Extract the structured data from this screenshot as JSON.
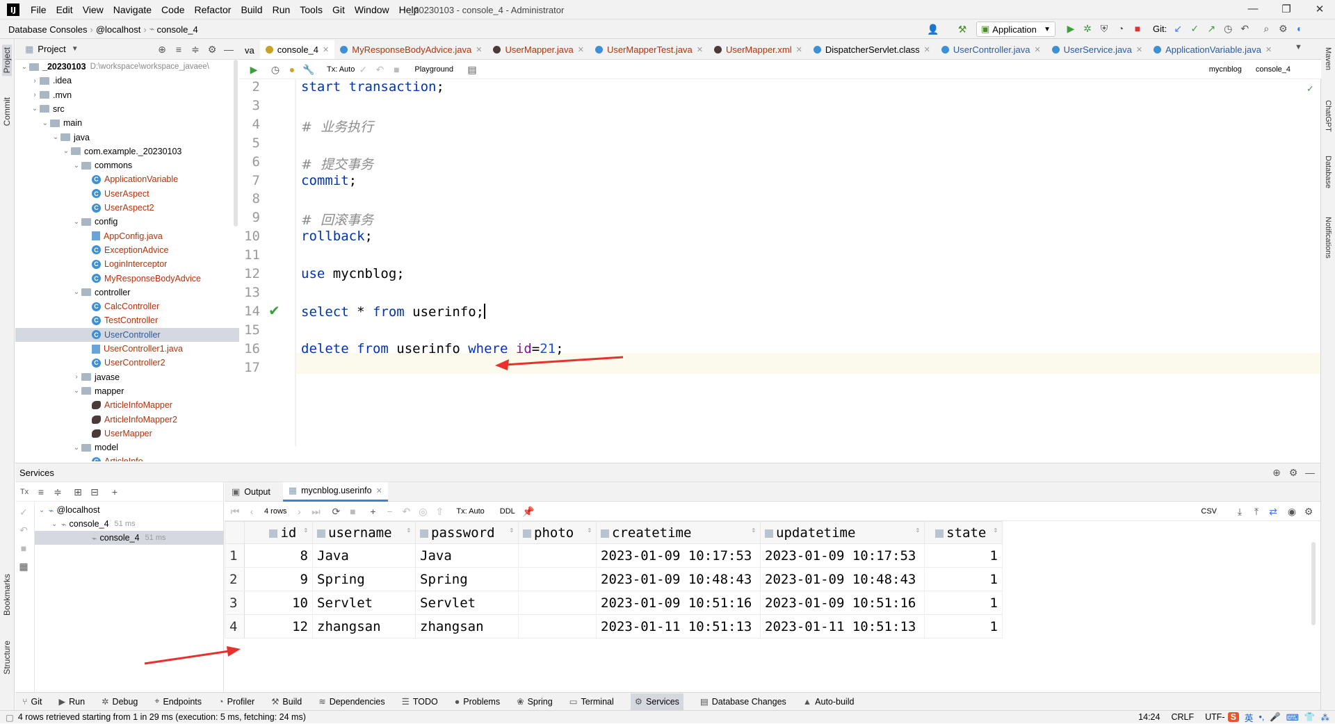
{
  "titlebar": {
    "logo": "IJ",
    "menu": [
      "File",
      "Edit",
      "View",
      "Navigate",
      "Code",
      "Refactor",
      "Build",
      "Run",
      "Tools",
      "Git",
      "Window",
      "Help"
    ],
    "window_title": "_20230103 - console_4 - Administrator"
  },
  "navbar": {
    "crumbs": [
      "Database Consoles",
      "@localhost",
      "console_4"
    ],
    "run_config": "Application",
    "git_label": "Git:"
  },
  "leftstrip": {
    "project": "Project",
    "commit": "Commit",
    "bookmarks": "Bookmarks",
    "structure": "Structure"
  },
  "rightstrip": {
    "maven": "Maven",
    "chatgpt": "ChatGPT",
    "database": "Database",
    "notifications": "Notifications"
  },
  "project": {
    "title": "Project",
    "tree": [
      {
        "d": 0,
        "arrow": "open",
        "type": "folder",
        "label": "_20230103",
        "hint": "D:\\workspace\\workspace_javaee\\",
        "bold": true
      },
      {
        "d": 1,
        "arrow": "closed",
        "type": "folder",
        "label": ".idea"
      },
      {
        "d": 1,
        "arrow": "closed",
        "type": "folder",
        "label": ".mvn"
      },
      {
        "d": 1,
        "arrow": "open",
        "type": "folder",
        "label": "src"
      },
      {
        "d": 2,
        "arrow": "open",
        "type": "folder",
        "label": "main"
      },
      {
        "d": 3,
        "arrow": "open",
        "type": "folder",
        "label": "java"
      },
      {
        "d": 4,
        "arrow": "open",
        "type": "folder",
        "label": "com.example._20230103"
      },
      {
        "d": 5,
        "arrow": "open",
        "type": "folder",
        "label": "commons"
      },
      {
        "d": 6,
        "type": "class",
        "label": "ApplicationVariable",
        "red": true
      },
      {
        "d": 6,
        "type": "class",
        "label": "UserAspect",
        "red": true
      },
      {
        "d": 6,
        "type": "class",
        "label": "UserAspect2",
        "red": true
      },
      {
        "d": 5,
        "arrow": "open",
        "type": "folder",
        "label": "config"
      },
      {
        "d": 6,
        "type": "file",
        "label": "AppConfig.java",
        "red": true
      },
      {
        "d": 6,
        "type": "class",
        "label": "ExceptionAdvice",
        "red": true
      },
      {
        "d": 6,
        "type": "class",
        "label": "LoginInterceptor",
        "red": true
      },
      {
        "d": 6,
        "type": "class",
        "label": "MyResponseBodyAdvice",
        "red": true
      },
      {
        "d": 5,
        "arrow": "open",
        "type": "folder",
        "label": "controller"
      },
      {
        "d": 6,
        "type": "class",
        "label": "CalcController",
        "red": true
      },
      {
        "d": 6,
        "type": "class",
        "label": "TestController",
        "red": true
      },
      {
        "d": 6,
        "type": "class",
        "label": "UserController",
        "selected": true,
        "blue": true
      },
      {
        "d": 6,
        "type": "file",
        "label": "UserController1.java",
        "red": true
      },
      {
        "d": 6,
        "type": "class",
        "label": "UserController2",
        "red": true
      },
      {
        "d": 5,
        "arrow": "closed",
        "type": "folder",
        "label": "javase"
      },
      {
        "d": 5,
        "arrow": "open",
        "type": "folder",
        "label": "mapper"
      },
      {
        "d": 6,
        "type": "bird",
        "label": "ArticleInfoMapper",
        "red": true
      },
      {
        "d": 6,
        "type": "bird",
        "label": "ArticleInfoMapper2",
        "red": true
      },
      {
        "d": 6,
        "type": "bird",
        "label": "UserMapper",
        "red": true
      },
      {
        "d": 5,
        "arrow": "open",
        "type": "folder",
        "label": "model"
      },
      {
        "d": 6,
        "type": "class",
        "label": "ArticleInfo",
        "red": true
      }
    ]
  },
  "tabs": [
    {
      "label": "va",
      "color": ""
    },
    {
      "label": "console_4",
      "active": true,
      "color": "#c9a227"
    },
    {
      "label": "MyResponseBodyAdvice.java",
      "color": "#3d8fd6",
      "red": true
    },
    {
      "label": "UserMapper.java",
      "color": "#4a3a3a",
      "red": true
    },
    {
      "label": "UserMapperTest.java",
      "color": "#3d8fd6",
      "red": true
    },
    {
      "label": "UserMapper.xml",
      "color": "#4a3a3a",
      "red": true
    },
    {
      "label": "DispatcherServlet.class",
      "color": "#3d8fd6"
    },
    {
      "label": "UserController.java",
      "color": "#3d8fd6",
      "blue": true
    },
    {
      "label": "UserService.java",
      "color": "#3d8fd6",
      "blue": true
    },
    {
      "label": "ApplicationVariable.java",
      "color": "#3d8fd6",
      "blue": true
    }
  ],
  "editor_toolbar": {
    "tx": "Tx: Auto",
    "playground": "Playground",
    "schema": "mycnblog",
    "console": "console_4"
  },
  "code": [
    {
      "n": "2",
      "parts": [
        [
          "kw",
          "start transaction"
        ],
        [
          "",
          "; "
        ]
      ]
    },
    {
      "n": "3",
      "parts": []
    },
    {
      "n": "4",
      "parts": [
        [
          "cm",
          "#  业务执行"
        ]
      ]
    },
    {
      "n": "5",
      "parts": []
    },
    {
      "n": "6",
      "parts": [
        [
          "cm",
          "#  提交事务"
        ]
      ]
    },
    {
      "n": "7",
      "parts": [
        [
          "kw",
          "commit"
        ],
        [
          "",
          ";"
        ]
      ]
    },
    {
      "n": "8",
      "parts": []
    },
    {
      "n": "9",
      "parts": [
        [
          "cm",
          "#  回滚事务"
        ]
      ]
    },
    {
      "n": "10",
      "parts": [
        [
          "kw",
          "rollback"
        ],
        [
          "",
          ";"
        ]
      ]
    },
    {
      "n": "11",
      "parts": []
    },
    {
      "n": "12",
      "parts": [
        [
          "kw",
          "use"
        ],
        [
          "",
          " mycnblog;"
        ]
      ]
    },
    {
      "n": "13",
      "parts": []
    },
    {
      "n": "14",
      "parts": [
        [
          "kw",
          "select"
        ],
        [
          "",
          " * "
        ],
        [
          "kw",
          "from"
        ],
        [
          "",
          " userinfo;"
        ]
      ],
      "check": true
    },
    {
      "n": "15",
      "parts": []
    },
    {
      "n": "16",
      "parts": [
        [
          "kw",
          "delete from"
        ],
        [
          "",
          " userinfo "
        ],
        [
          "kw",
          "where"
        ],
        [
          "",
          " "
        ],
        [
          "fn",
          "id"
        ],
        [
          "",
          "="
        ],
        [
          "num",
          "21"
        ],
        [
          "",
          ";"
        ]
      ]
    },
    {
      "n": "17",
      "parts": []
    }
  ],
  "services": {
    "title": "Services",
    "tree": [
      {
        "label": "@localhost"
      },
      {
        "label": "console_4",
        "time": "51 ms"
      },
      {
        "label": "console_4",
        "time": "51 ms"
      }
    ]
  },
  "result_tabs": {
    "output": "Output",
    "table": "mycnblog.userinfo"
  },
  "result_toolbar": {
    "rows": "4 rows",
    "tx": "Tx: Auto",
    "ddl": "DDL",
    "csv": "CSV"
  },
  "grid": {
    "columns": [
      "id",
      "username",
      "password",
      "photo",
      "createtime",
      "updatetime",
      "state"
    ],
    "rows": [
      [
        "1",
        "8",
        "Java",
        "Java",
        "",
        "2023-01-09 10:17:53",
        "2023-01-09 10:17:53",
        "1"
      ],
      [
        "2",
        "9",
        "Spring",
        "Spring",
        "",
        "2023-01-09 10:48:43",
        "2023-01-09 10:48:43",
        "1"
      ],
      [
        "3",
        "10",
        "Servlet",
        "Servlet",
        "",
        "2023-01-09 10:51:16",
        "2023-01-09 10:51:16",
        "1"
      ],
      [
        "4",
        "12",
        "zhangsan",
        "zhangsan",
        "",
        "2023-01-11 10:51:13",
        "2023-01-11 10:51:13",
        "1"
      ]
    ]
  },
  "toolwindows": [
    "Git",
    "Run",
    "Debug",
    "Endpoints",
    "Profiler",
    "Build",
    "Dependencies",
    "TODO",
    "Problems",
    "Spring",
    "Terminal",
    "Services",
    "Database Changes",
    "Auto-build"
  ],
  "status": {
    "message": "4 rows retrieved starting from 1 in 29 ms (execution: 5 ms, fetching: 24 ms)",
    "position": "14:24",
    "line_sep": "CRLF",
    "encoding": "UTF-",
    "ime": "英"
  },
  "colors": {
    "keyword": "#0033b3",
    "comment": "#8c8c8c",
    "arrow": "#e8312c",
    "accent": "#3d7ee0"
  }
}
